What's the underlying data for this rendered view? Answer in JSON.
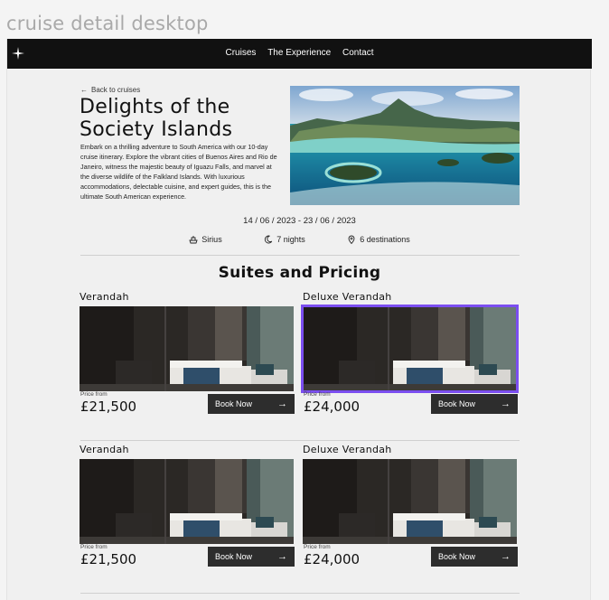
{
  "frame_label": "cruise detail desktop",
  "nav": {
    "links": [
      "Cruises",
      "The Experience",
      "Contact"
    ]
  },
  "back_link": "Back to cruises",
  "cruise": {
    "title_line1": "Delights of the",
    "title_line2": "Society Islands",
    "description": "Embark on a thrilling adventure to South America with our 10-day cruise itinerary. Explore the vibrant cities of Buenos Aires and Rio de Janeiro, witness the majestic beauty of Iguazu Falls, and marvel at the diverse wildlife of the Falkland Islands. With luxurious accommodations, delectable cuisine, and expert guides, this is the ultimate South American experience.",
    "dates": "14 / 06 / 2023  -  23 / 06 / 2023",
    "ship": "Sirius",
    "nights": "7 nights",
    "destinations": "6 destinations"
  },
  "suites_title": "Suites and Pricing",
  "suites": [
    {
      "name": "Verandah",
      "price_label": "Price from",
      "price": "£21,500",
      "button": "Book Now"
    },
    {
      "name": "Deluxe Verandah",
      "price_label": "Price from",
      "price": "£24,000",
      "button": "Book Now"
    },
    {
      "name": "Verandah",
      "price_label": "Price from",
      "price": "£21,500",
      "button": "Book Now"
    },
    {
      "name": "Deluxe Verandah",
      "price_label": "Price from",
      "price": "£24,000",
      "button": "Book Now"
    }
  ],
  "colors": {
    "nav_bg": "#111111",
    "button_bg": "#2d2d2d",
    "selection_outline": "#7b4ef0"
  }
}
